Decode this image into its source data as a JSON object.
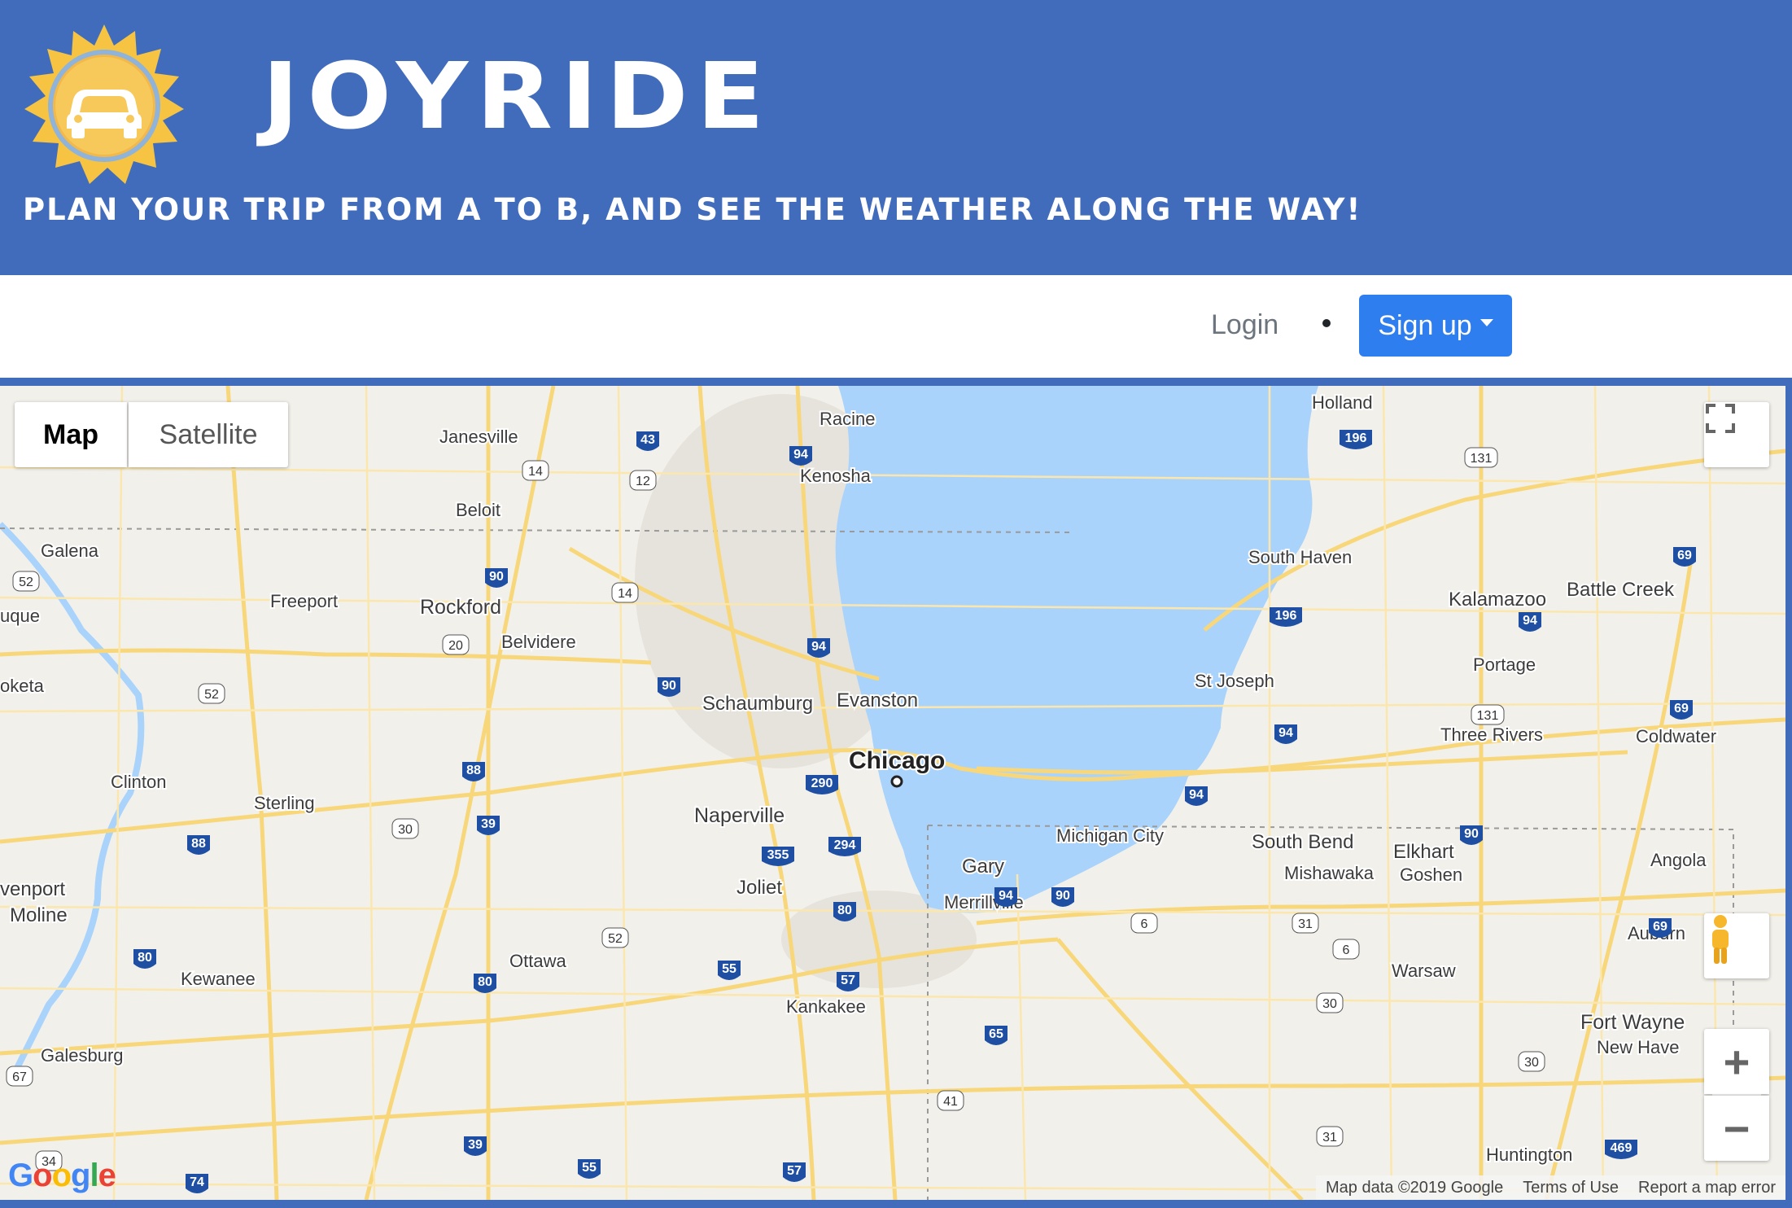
{
  "header": {
    "title": "JOYRIDE",
    "subtitle": "PLAN YOUR TRIP FROM A TO B, AND SEE THE WEATHER ALONG THE WAY!",
    "background_color": "#416cbc",
    "logo_icon": "car-sun-icon"
  },
  "nav": {
    "login_label": "Login",
    "signup_label": "Sign up",
    "signup_color": "#2f7ef0"
  },
  "map": {
    "type_control": {
      "map_label": "Map",
      "satellite_label": "Satellite",
      "selected": "Map"
    },
    "controls": {
      "zoom_in": "+",
      "zoom_out": "−",
      "fullscreen_icon": "fullscreen-icon",
      "pegman_icon": "pegman-icon"
    },
    "google_logo": "Google",
    "attribution": {
      "map_data": "Map data ©2019 Google",
      "terms": "Terms of Use",
      "report": "Report a map error"
    },
    "lake_color": "#aad3fb",
    "land_color": "#f2f0ea",
    "road_color": "#f8d77a",
    "cities": [
      "Janesville",
      "Racine",
      "Kenosha",
      "Beloit",
      "Holland",
      "Galena",
      "Freeport",
      "Rockford",
      "Belvidere",
      "South Haven",
      "Kalamazoo",
      "Battle Creek",
      "Schaumburg",
      "Evanston",
      "Chicago",
      "St Joseph",
      "Portage",
      "Three Rivers",
      "Coldwater",
      "Clinton",
      "Sterling",
      "Naperville",
      "Michigan City",
      "South Bend",
      "Elkhart",
      "Mishawaka",
      "Goshen",
      "Gary",
      "Merrillville",
      "Joliet",
      "Angola",
      "Moline",
      "Kewanee",
      "Ottawa",
      "Auburn",
      "Warsaw",
      "Kankakee",
      "Fort Wayne",
      "New Haven",
      "Galesburg",
      "Huntington",
      "Davenport",
      "Dubuque",
      "Maquoketa"
    ]
  }
}
